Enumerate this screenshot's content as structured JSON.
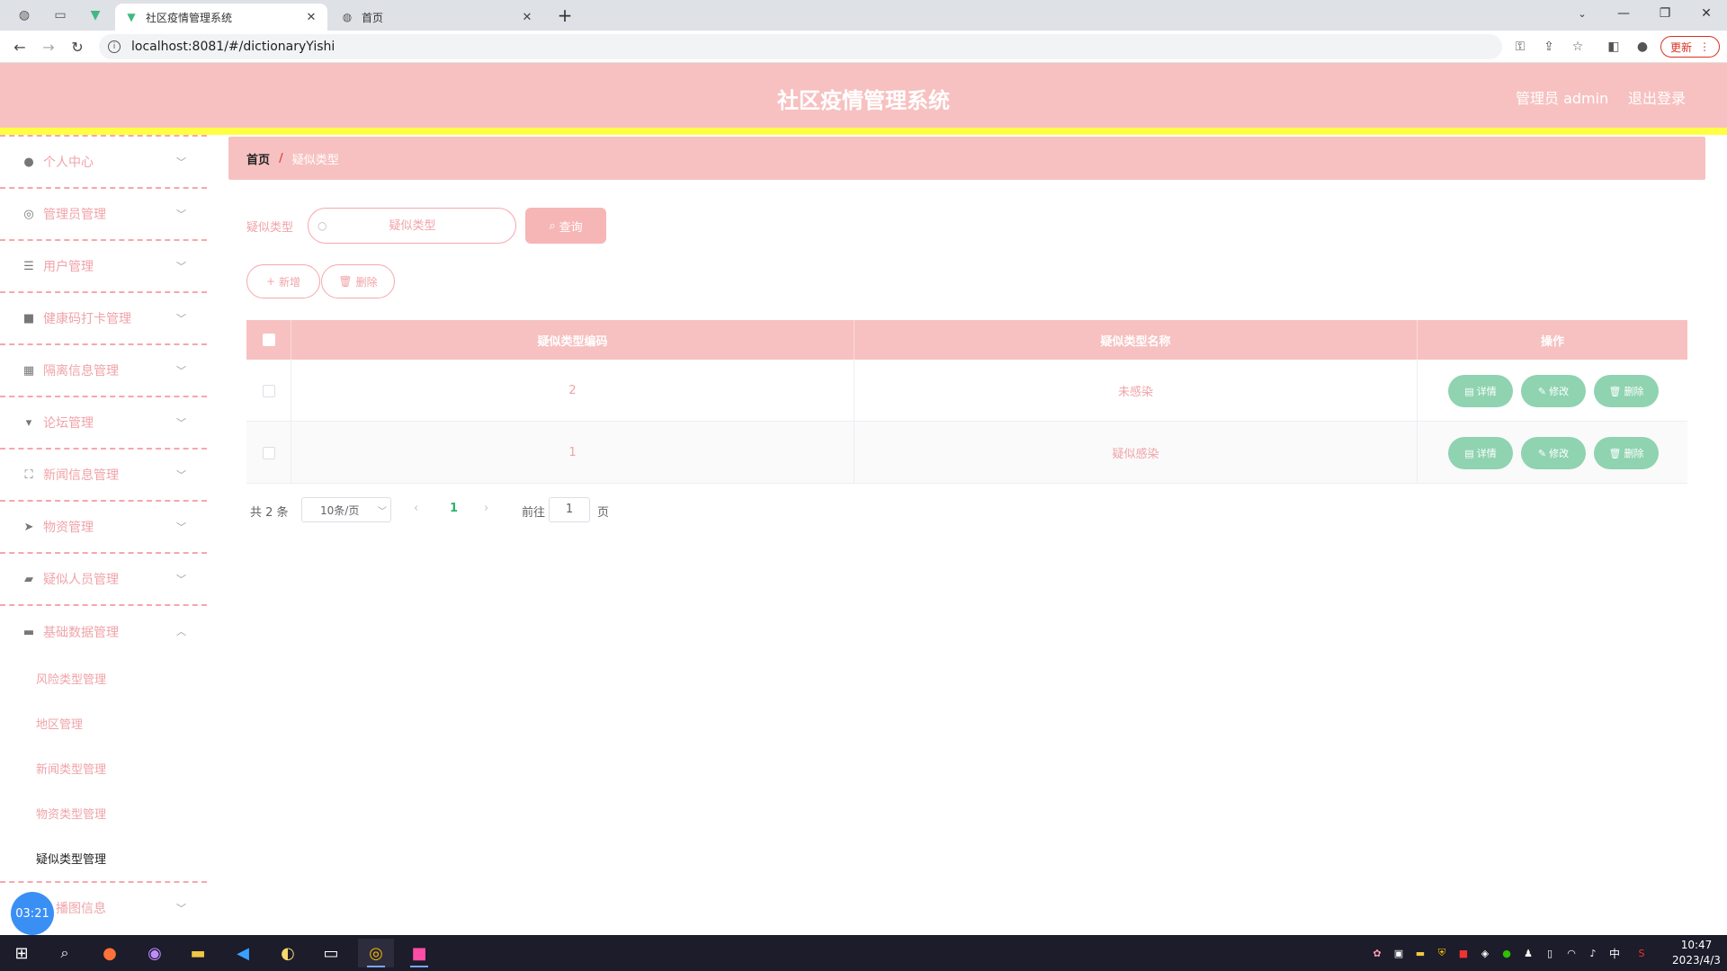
{
  "browser": {
    "tabs": [
      {
        "title": "社区疫情管理系统",
        "favicon": "vue-icon",
        "active": true
      },
      {
        "title": "首页",
        "favicon": "globe-icon",
        "active": false
      }
    ],
    "url": "localhost:8081/#/dictionaryYishi",
    "update_label": "更新"
  },
  "header": {
    "title": "社区疫情管理系统",
    "user": "管理员 admin",
    "logout": "退出登录"
  },
  "sidebar": {
    "items": [
      {
        "label": "个人中心",
        "icon": "user-icon"
      },
      {
        "label": "管理员管理",
        "icon": "admin-icon"
      },
      {
        "label": "用户管理",
        "icon": "sliders-icon"
      },
      {
        "label": "健康码打卡管理",
        "icon": "briefcase-icon"
      },
      {
        "label": "隔离信息管理",
        "icon": "grid-icon"
      },
      {
        "label": "论坛管理",
        "icon": "forum-icon"
      },
      {
        "label": "新闻信息管理",
        "icon": "fullscreen-icon"
      },
      {
        "label": "物资管理",
        "icon": "send-icon"
      },
      {
        "label": "疑似人员管理",
        "icon": "camera-icon"
      },
      {
        "label": "基础数据管理",
        "icon": "database-icon"
      }
    ],
    "sub_items": [
      "风险类型管理",
      "地区管理",
      "新闻类型管理",
      "物资类型管理",
      "疑似类型管理"
    ],
    "last_item": {
      "label": "播图信息",
      "icon": "image-icon"
    },
    "timer": "03:21"
  },
  "breadcrumb": {
    "home": "首页",
    "sep": "/",
    "current": "疑似类型"
  },
  "search": {
    "label": "疑似类型",
    "placeholder": "疑似类型",
    "button": "查询"
  },
  "actions": {
    "add": "新增",
    "delete": "删除"
  },
  "table": {
    "headers": [
      "疑似类型编码",
      "疑似类型名称",
      "操作"
    ],
    "rows": [
      {
        "code": "2",
        "name": "未感染"
      },
      {
        "code": "1",
        "name": "疑似感染"
      }
    ],
    "ops": {
      "detail": "详情",
      "edit": "修改",
      "delete": "删除"
    }
  },
  "pagination": {
    "total": "共 2 条",
    "page_size": "10条/页",
    "current": "1",
    "goto_prefix": "前往",
    "goto_value": "1",
    "goto_suffix": "页"
  },
  "taskbar": {
    "time": "10:47",
    "date": "2023/4/3",
    "ime": "中"
  },
  "colors": {
    "header_bg": "#f7c1c1",
    "accent_pink": "#f0a3a8",
    "op_green": "#8fd3b1",
    "strip_yellow": "#ffff44"
  }
}
